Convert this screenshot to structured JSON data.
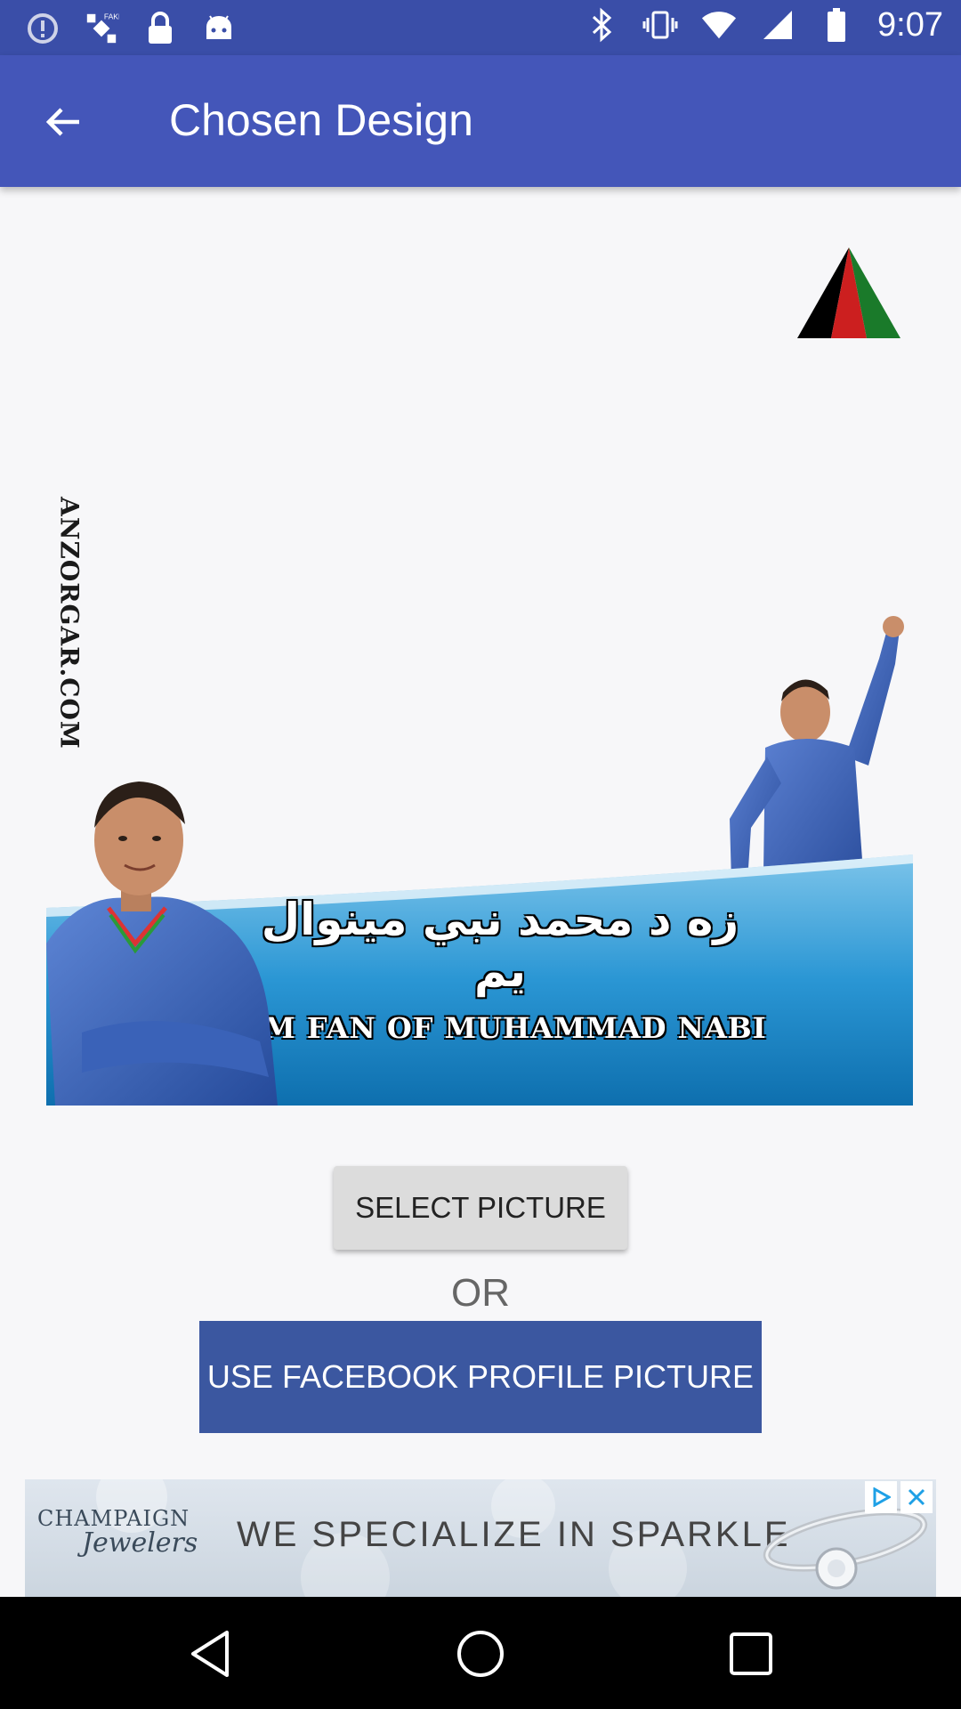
{
  "status_bar": {
    "time": "9:07",
    "left_icons": [
      "alert-circle-icon",
      "fake-gps-icon",
      "lock-icon",
      "android-icon"
    ],
    "right_icons": [
      "bluetooth-icon",
      "vibrate-icon",
      "wifi-icon",
      "signal-icon",
      "battery-icon"
    ]
  },
  "app_bar": {
    "title": "Chosen Design",
    "back_icon": "arrow-back-icon",
    "color": "#4456b9"
  },
  "design": {
    "watermark": "ANZORGAR.COM",
    "urdu_text": "زه د محمد نبي مينوال يم",
    "english_text": "I AM FAN OF MUHAMMAD NABI",
    "flag_colors": [
      "#000000",
      "#cc1f1f",
      "#1a7a2a"
    ]
  },
  "actions": {
    "select_picture": "SELECT PICTURE",
    "or": "OR",
    "facebook_picture": "USE FACEBOOK PROFILE PICTURE",
    "facebook_color": "#3b57a0"
  },
  "ad": {
    "logo_line1": "CHAMPAIGN",
    "logo_line2": "Jewelers",
    "headline": "WE SPECIALIZE IN SPARKLE"
  },
  "nav_bar": {
    "buttons": [
      "back-triangle-icon",
      "home-circle-icon",
      "recents-square-icon"
    ]
  }
}
